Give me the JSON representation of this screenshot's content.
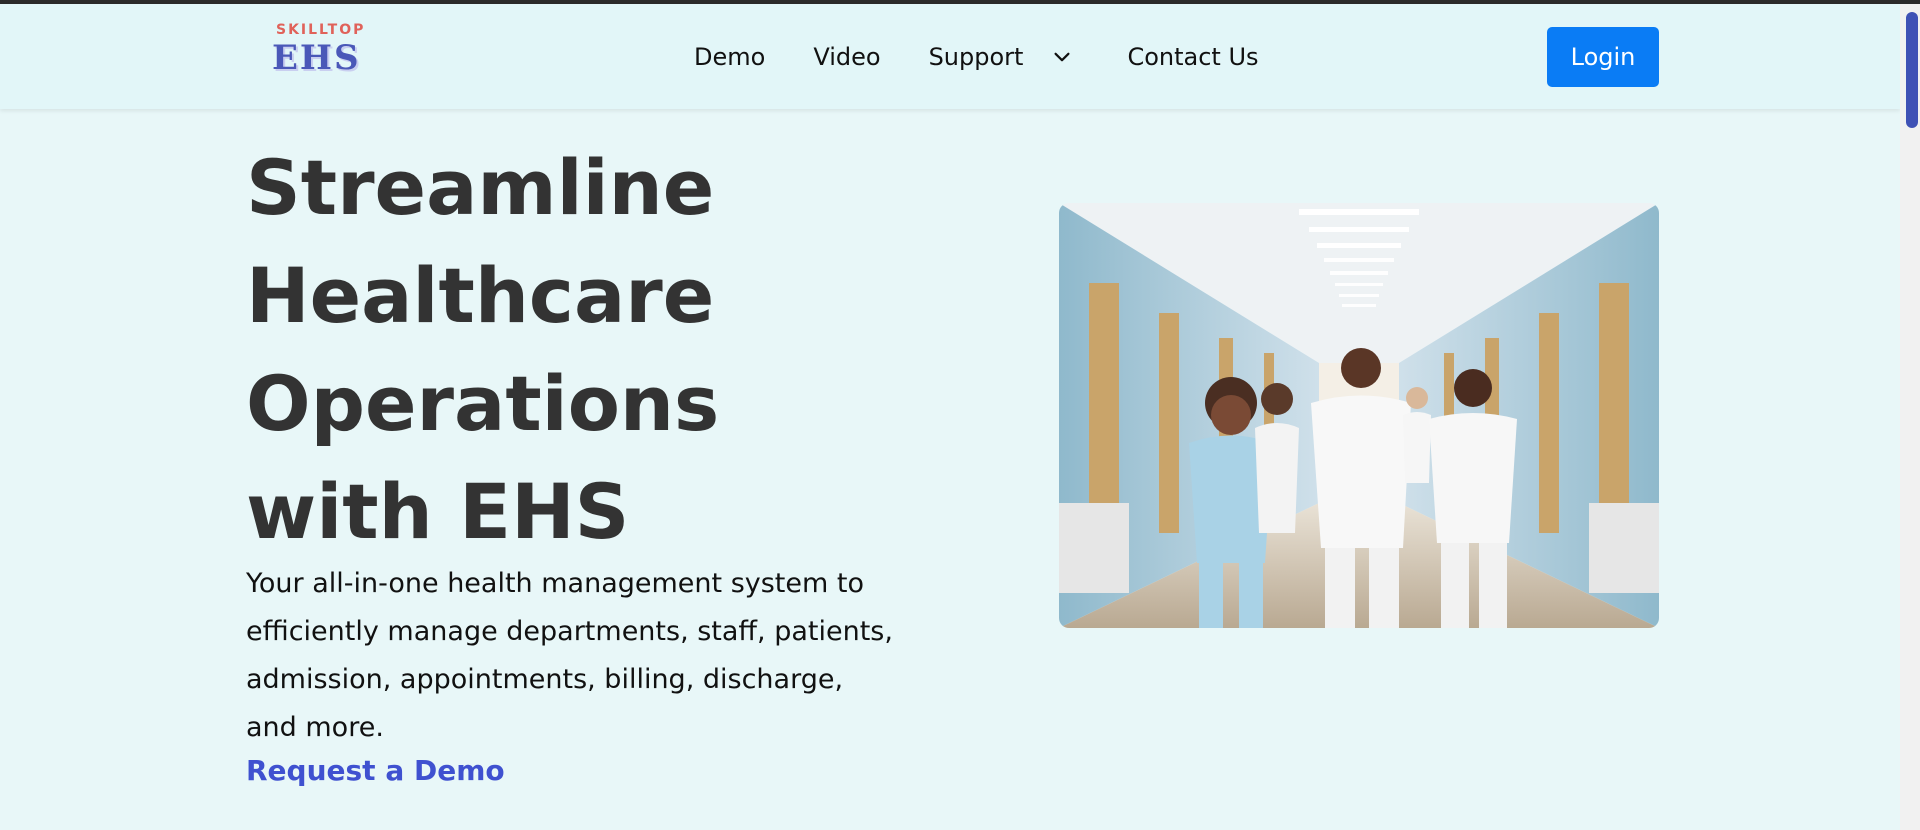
{
  "brand": {
    "logo_top": "SKILLTOP",
    "logo_main": "EHS"
  },
  "nav": {
    "items": [
      {
        "label": "Demo"
      },
      {
        "label": "Video"
      },
      {
        "label": "Support",
        "has_dropdown": true
      },
      {
        "label": "Contact Us"
      }
    ],
    "login_label": "Login"
  },
  "hero": {
    "title": "Streamline Healthcare Operations with EHS",
    "description": "Your all-in-one health management system to efficiently manage departments, staff, patients, admission, appointments, billing, discharge, and more.",
    "cta_label": "Request a Demo",
    "image_subject": "Healthcare staff walking in a hospital corridor"
  },
  "colors": {
    "page_bg": "#e8f7f8",
    "nav_bg": "#e2f6f8",
    "login_bg": "#0a7cf5",
    "cta": "#3f51d0",
    "scrollbar_thumb": "#3f51b5",
    "logo_top": "#e0625a",
    "logo_main": "#4a58b8"
  }
}
